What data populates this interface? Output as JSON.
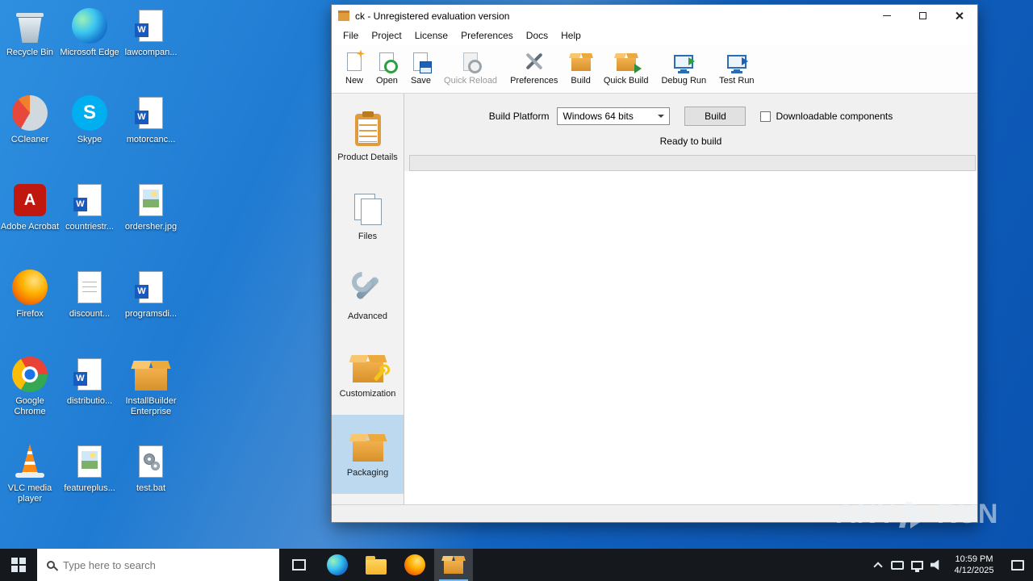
{
  "desktop": {
    "icons": [
      {
        "label": "Recycle Bin"
      },
      {
        "label": "Microsoft Edge"
      },
      {
        "label": "lawcompan..."
      },
      {
        "label": "CCleaner"
      },
      {
        "label": "Skype"
      },
      {
        "label": "motorcanc..."
      },
      {
        "label": "Adobe Acrobat"
      },
      {
        "label": "countriestr..."
      },
      {
        "label": "ordersher.jpg"
      },
      {
        "label": "Firefox"
      },
      {
        "label": "discount..."
      },
      {
        "label": "programsdi..."
      },
      {
        "label": "Google Chrome"
      },
      {
        "label": "distributio..."
      },
      {
        "label": "InstallBuilder Enterprise"
      },
      {
        "label": "VLC media player"
      },
      {
        "label": "featureplus..."
      },
      {
        "label": "test.bat"
      }
    ]
  },
  "window": {
    "title": "ck - Unregistered evaluation version",
    "menu": [
      "File",
      "Project",
      "License",
      "Preferences",
      "Docs",
      "Help"
    ],
    "toolbar": [
      {
        "label": "New"
      },
      {
        "label": "Open"
      },
      {
        "label": "Save"
      },
      {
        "label": "Quick Reload"
      },
      {
        "label": "Preferences"
      },
      {
        "label": "Build"
      },
      {
        "label": "Quick Build"
      },
      {
        "label": "Debug Run"
      },
      {
        "label": "Test Run"
      }
    ],
    "sidebar": [
      {
        "label": "Product Details"
      },
      {
        "label": "Files"
      },
      {
        "label": "Advanced"
      },
      {
        "label": "Customization"
      },
      {
        "label": "Packaging"
      }
    ],
    "build_panel": {
      "platform_label": "Build Platform",
      "platform_value": "Windows 64 bits",
      "build_button": "Build",
      "downloadable_label": "Downloadable components",
      "status": "Ready to build"
    }
  },
  "taskbar": {
    "search_placeholder": "Type here to search",
    "time": "10:59 PM",
    "date": "4/12/2025"
  },
  "watermark": {
    "left": "ANY",
    "right": "RUN"
  },
  "glyphs": {
    "word": "W",
    "skype": "S",
    "adobe": "A"
  }
}
